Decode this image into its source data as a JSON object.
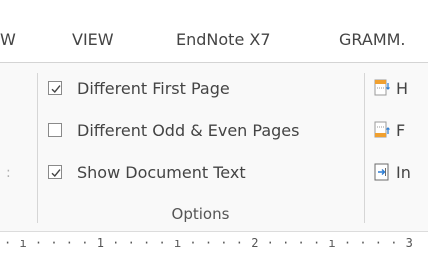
{
  "tabs": {
    "items": [
      "W",
      "VIEW",
      "EndNote X7",
      "GRAMM."
    ]
  },
  "options_group": {
    "title": "Options",
    "items": [
      {
        "label": "Different First Page",
        "checked": true
      },
      {
        "label": "Different Odd & Even Pages",
        "checked": false
      },
      {
        "label": "Show Document Text",
        "checked": true
      }
    ]
  },
  "right_commands": {
    "items": [
      {
        "label": "H",
        "icon": "header-position-icon"
      },
      {
        "label": "F",
        "icon": "footer-position-icon"
      },
      {
        "label": "In",
        "icon": "insert-alignment-tab-icon"
      }
    ]
  },
  "ruler": {
    "text": "· ı · · · · 1 · · · · ı · · · · 2 · · · · ı · · · · 3"
  },
  "left_edge_text": ":",
  "colors": {
    "accent_orange": "#f0a030",
    "accent_blue": "#2b7cd3",
    "check": "#444444"
  }
}
